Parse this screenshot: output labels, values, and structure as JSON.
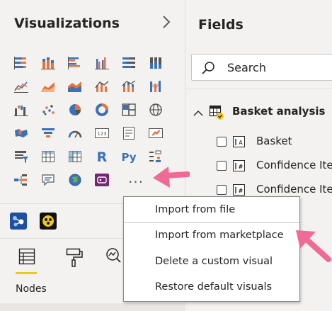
{
  "visualizations": {
    "title": "Visualizations",
    "expand_icon": "chevron-right-icon",
    "more_label": "...",
    "tiles": [
      "stacked-bar-chart-icon",
      "stacked-column-chart-icon",
      "clustered-bar-chart-icon",
      "clustered-column-chart-icon",
      "100-percent-bar-chart-icon",
      "100-percent-column-chart-icon",
      "line-chart-icon",
      "area-chart-icon",
      "stacked-area-chart-icon",
      "line-and-column-chart-icon",
      "line-and-stacked-column-chart-icon",
      "ribbon-chart-icon",
      "waterfall-chart-icon",
      "scatter-chart-icon",
      "pie-chart-icon",
      "donut-chart-icon",
      "treemap-icon",
      "map-icon",
      "filled-map-icon",
      "funnel-icon",
      "gauge-icon",
      "card-icon",
      "multi-row-card-icon",
      "kpi-icon",
      "slicer-icon",
      "table-icon",
      "matrix-icon",
      "r-visual-icon",
      "python-visual-icon",
      "key-influencers-icon",
      "decomposition-tree-icon",
      "qa-icon",
      "arcgis-map-icon",
      "power-apps-icon"
    ],
    "custom_visuals": [
      "network-navigator-icon",
      "custom-visual-icon"
    ],
    "tools": [
      "fields-tool-icon",
      "format-paint-roller-icon",
      "analytics-magnifier-icon"
    ],
    "active_tool_label": "Nodes"
  },
  "fields": {
    "title": "Fields",
    "search": {
      "label": "Search",
      "icon": "search-icon"
    },
    "table": {
      "name": "Basket analysis",
      "expanded": true,
      "fields": [
        {
          "name": "Basket"
        },
        {
          "name": "Confidence Ite"
        },
        {
          "name": "Confidence Ite"
        }
      ]
    }
  },
  "context_menu": {
    "items": [
      {
        "label": "Import from file"
      },
      {
        "label": "Import from marketplace"
      },
      {
        "label": "Delete a custom visual"
      },
      {
        "label": "Restore default visuals"
      }
    ]
  },
  "colors": {
    "accent_yellow": "#f2c811",
    "pane_bg": "#f3f2f1",
    "highlight_pink": "#f06a96",
    "icon_orange": "#e6733e",
    "icon_blue": "#3a71b8"
  }
}
